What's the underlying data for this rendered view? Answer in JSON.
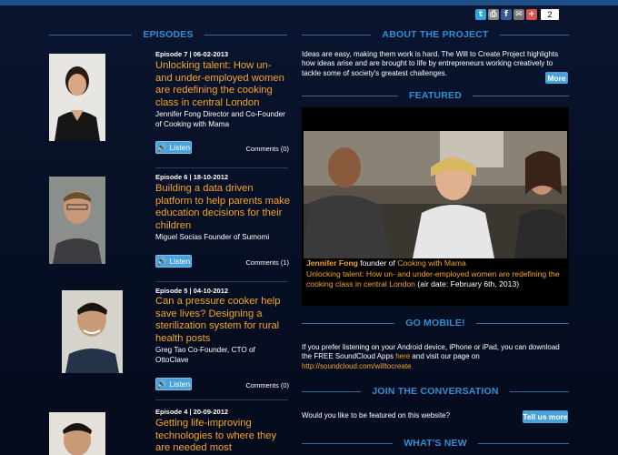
{
  "share": {
    "icons": [
      "twitter-icon",
      "print-icon",
      "facebook-icon",
      "email-icon",
      "more-share-icon"
    ],
    "count": "2",
    "colors": {
      "twitter": "#2ea7e0",
      "print": "#888888",
      "facebook": "#3b5998",
      "email": "#777777",
      "more": "#d9534f"
    }
  },
  "episodes_section": {
    "heading": "EPISODES"
  },
  "episodes": [
    {
      "meta": "Episode 7 | 06-02-2013",
      "title": "Unlocking talent: How un- and under-employed women are redefining the cooking class in central London",
      "guest": "Jennifer Fong Director and Co-Founder of Cooking with Mama",
      "listen": "Listen",
      "comments": "Comments (0)"
    },
    {
      "meta": "Episode 6 | 18-10-2012",
      "title": "Building a data driven platform to help parents make education decisions for their children",
      "guest": "Miguel Socias Founder of Sumomi",
      "listen": "Listen",
      "comments": "Comments (1)"
    },
    {
      "meta": "Episode 5 | 04-10-2012",
      "title": "Can a pressure cooker help save lives? Designing a sterilization system for rural health posts",
      "guest": "Greg Tao Co-Founder, CTO of OttoClave",
      "listen": "Listen",
      "comments": "Comments (0)"
    },
    {
      "meta": "Episode 4 | 20-09-2012",
      "title": "Getting life-improving technologies to where they are needed most",
      "guest": "",
      "listen": "",
      "comments": ""
    }
  ],
  "about": {
    "heading": "ABOUT THE PROJECT",
    "text": "Ideas are easy, making them work is hard. The Will to Create Project highlights how ideas arise and are brought to life by entrepreneurs working creatively to tackle some of society's greatest challenges.",
    "more": "More"
  },
  "featured": {
    "heading": "FEATURED",
    "name": "Jennifer Fong",
    "role_pre": " founder of ",
    "org": "Cooking with Mama",
    "title": "Unlocking talent: How un- and under-employed women are redefining the cooking class in central London",
    "air": " (air date: February 6th, 2013)"
  },
  "mobile": {
    "heading": "GO MOBILE!",
    "text_pre": "If you prefer listening on your Android device, iPhone or iPad, you can download the FREE SoundCloud Apps ",
    "link_here": "here",
    "text_mid": " and visit our page on ",
    "link_url": "http://soundcloud.com/willtocreate"
  },
  "conversation": {
    "heading": "JOIN THE CONVERSATION",
    "text": "Would you like to be featured on this website?",
    "button": "Tell us more"
  },
  "whatsnew": {
    "heading": "WHAT'S NEW"
  },
  "colors": {
    "accent_blue": "#2e8fd6",
    "orange": "#f5a623",
    "button_blue": "#4aa3d8",
    "background": "#071026"
  }
}
